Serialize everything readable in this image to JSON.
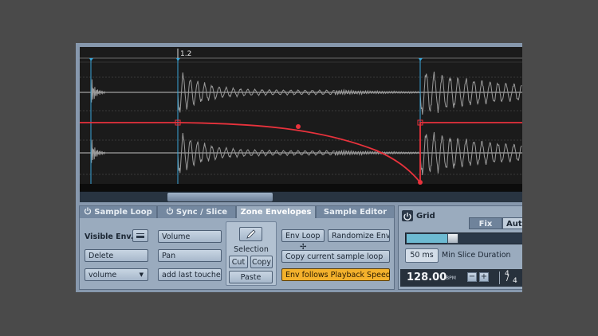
{
  "waveform": {
    "marker_label": "1.2",
    "colors": {
      "background": "#1b1b1b",
      "waveform": "#9a9a9a",
      "envelope": "#e8323c",
      "slice_marker": "#3aa6d8"
    }
  },
  "tabs": [
    {
      "label": "Sample Loop",
      "active": false,
      "icon": "power-icon"
    },
    {
      "label": "Sync / Slice",
      "active": false,
      "icon": "power-icon"
    },
    {
      "label": "Zone Envelopes",
      "active": true
    },
    {
      "label": "Sample Editor",
      "active": false
    }
  ],
  "zone_envelopes": {
    "visible_env_label": "Visible Env.",
    "delete_label": "Delete",
    "env_dropdown_value": "volume",
    "volume_label": "Volume",
    "pan_label": "Pan",
    "add_last_touched_label": "add last touched",
    "selection": {
      "label": "Selection",
      "cut_label": "Cut",
      "copy_label": "Copy",
      "paste_label": "Paste"
    },
    "env_loop_label": "Env Loop",
    "randomize_label": "Randomize Env",
    "copy_loop_label": "Copy current sample loop",
    "follows_playback_label": "Env follows Playback Speed"
  },
  "grid": {
    "title": "Grid",
    "fix_label": "Fix",
    "auto_label": "Aut",
    "min_slice_value": "50 ms",
    "min_slice_label": "Min Slice Duration",
    "slider_fraction": 0.38,
    "bpm_value": "128.00",
    "bpm_unit": "BPM",
    "minus_label": "−",
    "plus_label": "+",
    "sig_top": "4",
    "sig_bottom": "4"
  }
}
